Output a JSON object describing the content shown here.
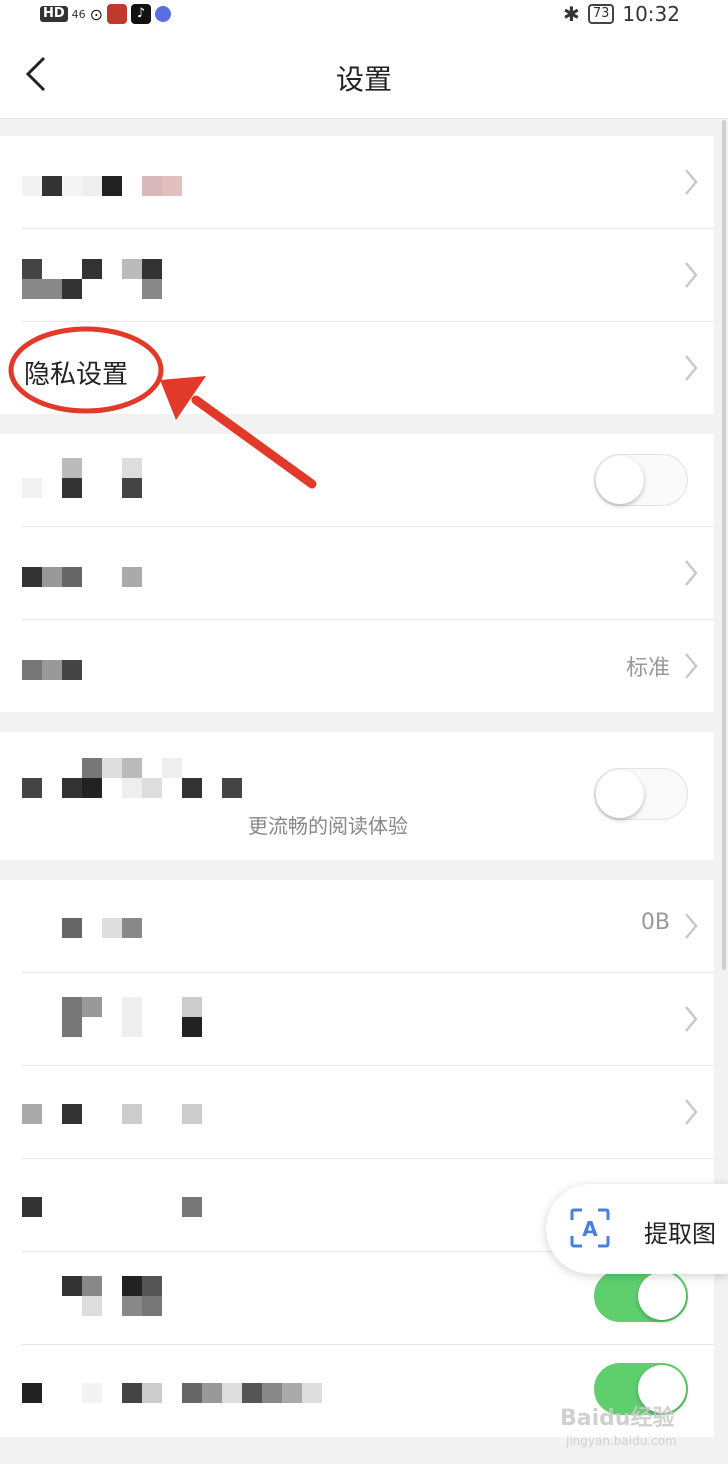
{
  "status_bar": {
    "hd": "HD",
    "signal": "46",
    "battery": "73",
    "time": "10:32",
    "bluetooth_icon": "bluetooth-icon"
  },
  "nav": {
    "title": "设置",
    "back_icon": "chevron-left-icon"
  },
  "settings": {
    "privacy_label": "隐私设置",
    "standard_value": "标准",
    "reading_subtitle": "更流畅的阅读体验",
    "cache_value": "0B"
  },
  "toggles": {
    "row4": false,
    "row7": false,
    "row12": true,
    "row13": true
  },
  "fab": {
    "label": "提取图",
    "icon": "text-scan-icon"
  },
  "watermark": {
    "brand": "Baidu经验",
    "url": "jingyan.baidu.com"
  },
  "colors": {
    "toggle_on": "#5fcf6e",
    "annotation_red": "#e23a2a",
    "page_bg": "#f2f2f2"
  }
}
